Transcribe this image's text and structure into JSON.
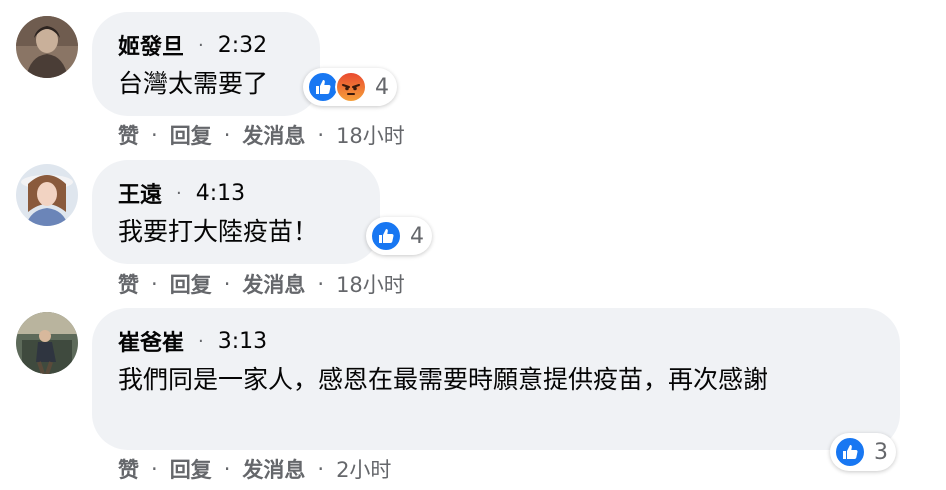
{
  "comments": [
    {
      "author": "姬發旦",
      "time": "2:32",
      "text": "台灣太需要了",
      "reactions": {
        "icons": [
          "like-icon",
          "angry-icon"
        ],
        "count": "4"
      },
      "actions": {
        "like": "赞",
        "reply": "回复",
        "message": "发消息",
        "age": "18小时"
      }
    },
    {
      "author": "王遠",
      "time": "4:13",
      "text": "我要打大陸疫苗！",
      "reactions": {
        "icons": [
          "like-icon"
        ],
        "count": "4"
      },
      "actions": {
        "like": "赞",
        "reply": "回复",
        "message": "发消息",
        "age": "18小时"
      }
    },
    {
      "author": "崔爸崔",
      "time": "3:13",
      "text": "我們同是一家人，感恩在最需要時願意提供疫苗，再次感謝",
      "reactions": {
        "icons": [
          "like-icon"
        ],
        "count": "3"
      },
      "actions": {
        "like": "赞",
        "reply": "回复",
        "message": "发消息",
        "age": "2小时"
      }
    }
  ],
  "separator": "·",
  "colors": {
    "like": "#1877f2",
    "angry": "#f0622a",
    "bubble": "#f0f2f5",
    "meta": "#65676b"
  }
}
